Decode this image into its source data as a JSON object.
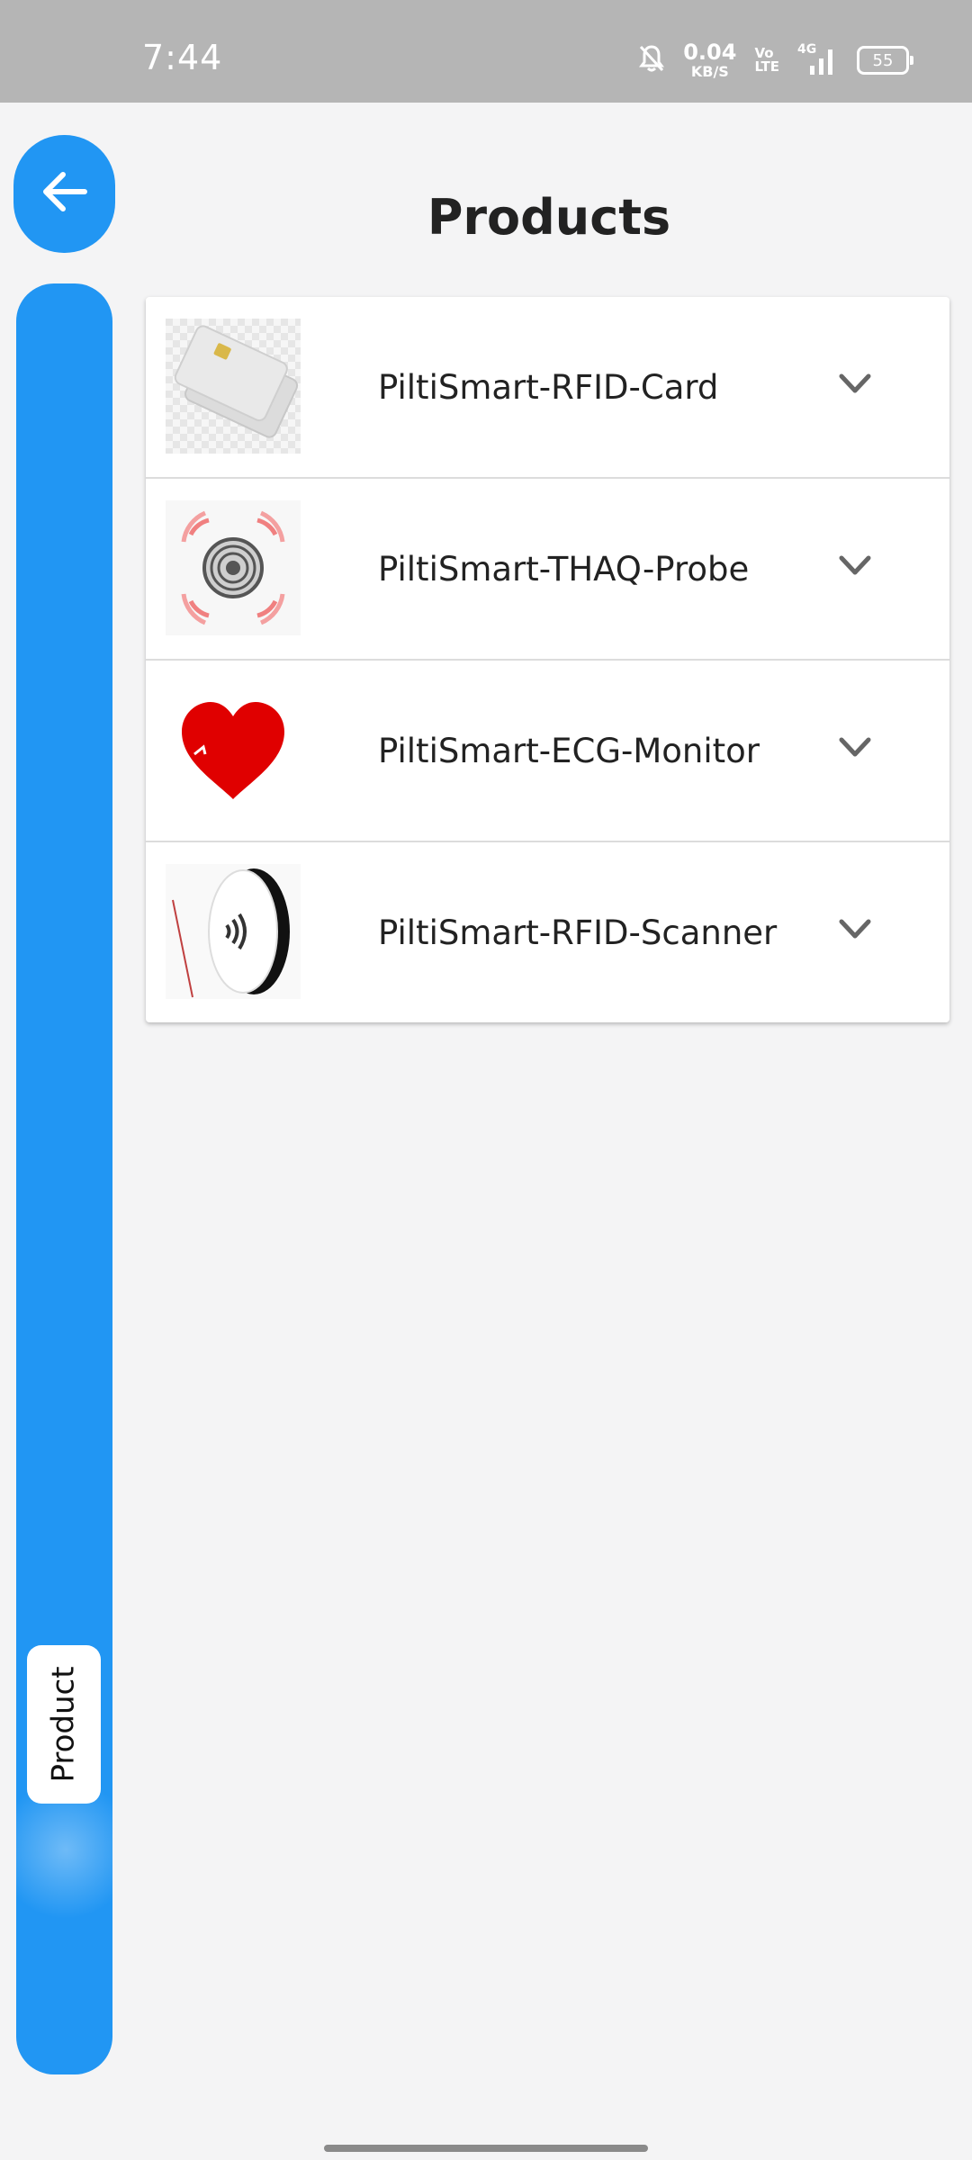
{
  "status_bar": {
    "time": "7:44",
    "net_speed_value": "0.04",
    "net_speed_unit": "KB/S",
    "volte_top": "Vo",
    "volte_bottom": "LTE",
    "network_type": "4G",
    "battery": "55",
    "icons": [
      "bell-off-icon",
      "volte-icon",
      "signal-icon",
      "battery-icon"
    ]
  },
  "header": {
    "title": "Products",
    "back_icon": "arrow-left-icon"
  },
  "sidebar": {
    "active_tab": "Product"
  },
  "products": [
    {
      "name": "PiltiSmart-RFID-Card",
      "thumb": "rfid-card-image",
      "expanded": false
    },
    {
      "name": "PiltiSmart-THAQ-Probe",
      "thumb": "thaq-probe-image",
      "expanded": false
    },
    {
      "name": "PiltiSmart-ECG-Monitor",
      "thumb": "heart-image",
      "expanded": false
    },
    {
      "name": "PiltiSmart-RFID-Scanner",
      "thumb": "rfid-scanner-image",
      "expanded": false
    }
  ],
  "colors": {
    "accent": "#2196f3",
    "background": "#f4f4f5",
    "status_bar": "#b5b5b5",
    "heart": "#e00000"
  }
}
